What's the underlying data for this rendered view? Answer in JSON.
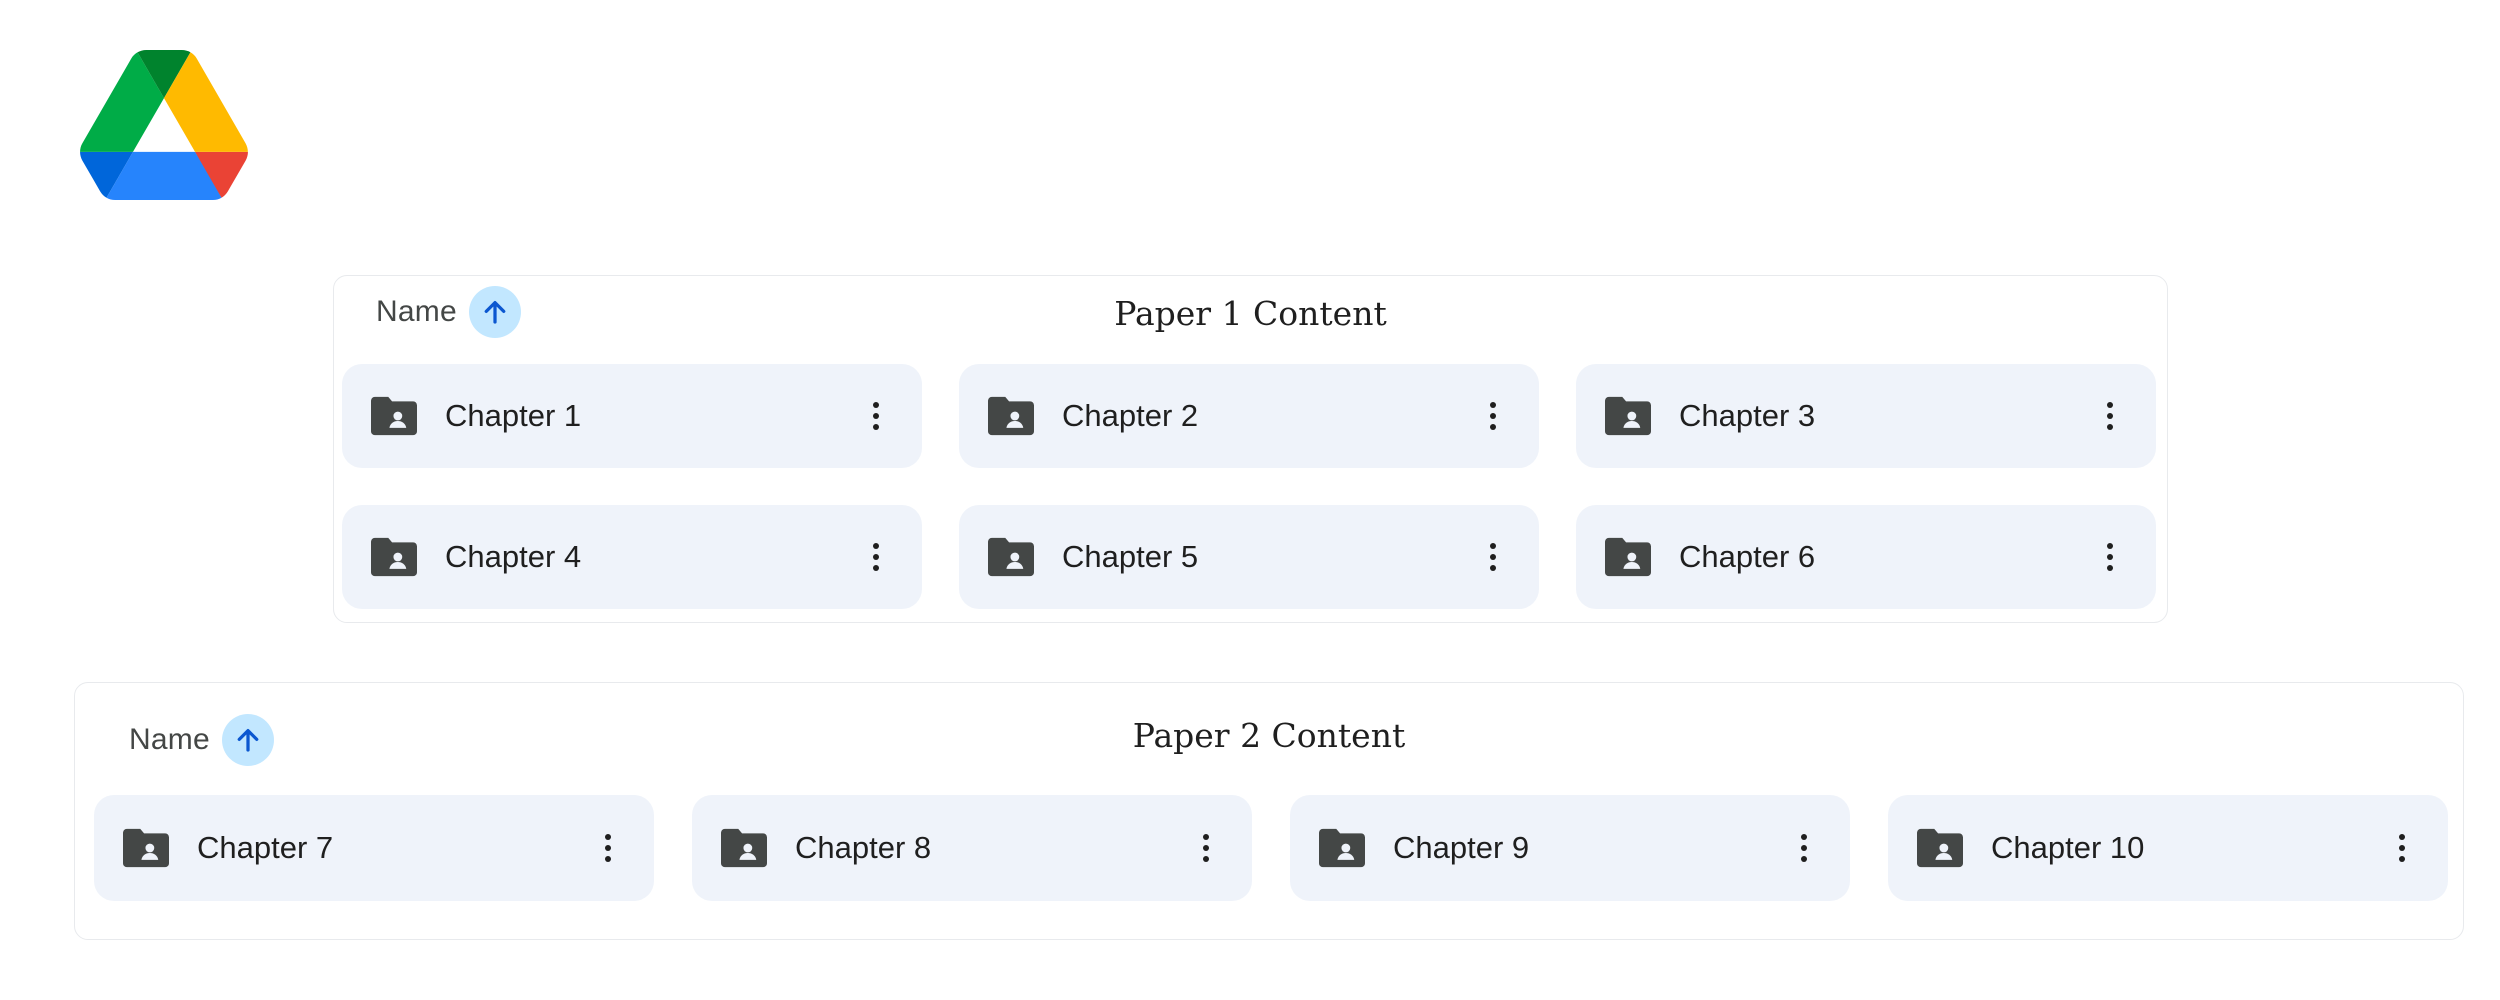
{
  "logo": {
    "icon": "google-drive-logo"
  },
  "colors": {
    "card_bg": "#eff3fa",
    "sort_button_bg": "#c2e7ff",
    "sort_arrow": "#0b57d0",
    "icon": "#444746",
    "text": "#1f1f1f"
  },
  "panels": [
    {
      "title": "Paper 1 Content",
      "sort_label": "Name",
      "sort_icon": "arrow-up-icon",
      "items": [
        {
          "label": "Chapter 1",
          "icon": "shared-folder-icon"
        },
        {
          "label": "Chapter 2",
          "icon": "shared-folder-icon"
        },
        {
          "label": "Chapter 3",
          "icon": "shared-folder-icon"
        },
        {
          "label": "Chapter 4",
          "icon": "shared-folder-icon"
        },
        {
          "label": "Chapter 5",
          "icon": "shared-folder-icon"
        },
        {
          "label": "Chapter 6",
          "icon": "shared-folder-icon"
        }
      ]
    },
    {
      "title": "Paper 2 Content",
      "sort_label": "Name",
      "sort_icon": "arrow-up-icon",
      "items": [
        {
          "label": "Chapter 7",
          "icon": "shared-folder-icon"
        },
        {
          "label": "Chapter 8",
          "icon": "shared-folder-icon"
        },
        {
          "label": "Chapter 9",
          "icon": "shared-folder-icon"
        },
        {
          "label": "Chapter 10",
          "icon": "shared-folder-icon"
        }
      ]
    }
  ]
}
